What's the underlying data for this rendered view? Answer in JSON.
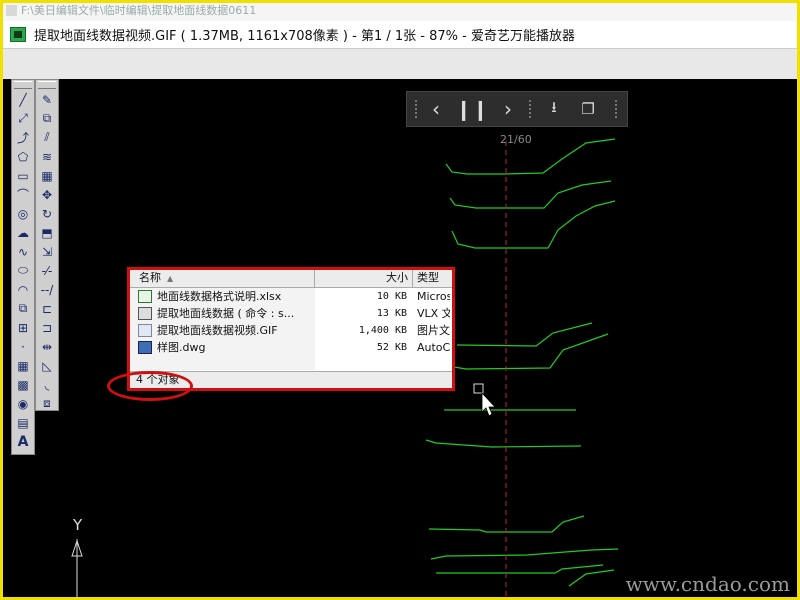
{
  "breadcrumb_path": "F:\\美日编辑文件\\临时编辑\\提取地面线数据0611",
  "window": {
    "title": "提取地面线数据视频.GIF ( 1.37MB, 1161x708像素 ) - 第1 / 1张 - 87% - 爱奇艺万能播放器"
  },
  "viewer": {
    "prev_icon": "chevron-left",
    "pause_icon": "pause",
    "next_icon": "chevron-right",
    "save_icon": "download",
    "copy_icon": "copy",
    "page_counter": "21/60"
  },
  "explorer": {
    "columns": {
      "name": "名称",
      "size": "大小",
      "type": "类型"
    },
    "files": [
      {
        "name": "地面线数据格式说明.xlsx",
        "size": "10 KB",
        "type": "Micros",
        "icon": "excel-file-icon"
      },
      {
        "name": "提取地面线数据 ( 命令 : s...",
        "size": "13 KB",
        "type": "VLX 文",
        "icon": "vlx-file-icon"
      },
      {
        "name": "提取地面线数据视频.GIF",
        "size": "1,400 KB",
        "type": "图片文",
        "icon": "image-file-icon"
      },
      {
        "name": "样图.dwg",
        "size": "52 KB",
        "type": "AutoCA",
        "icon": "dwg-file-icon"
      }
    ],
    "status": "4 个对象"
  },
  "cad": {
    "ucs_y_label": "Y",
    "toolbar_left": [
      "line",
      "xline",
      "pline",
      "polygon",
      "rectangle",
      "arc",
      "circle",
      "revcloud",
      "spline",
      "ellipse",
      "ellipse-arc",
      "insert-block",
      "make-block",
      "point",
      "hatch",
      "gradient",
      "region",
      "table",
      "mtext"
    ],
    "toolbar_modify": [
      "erase",
      "copy",
      "mirror",
      "offset",
      "array",
      "move",
      "rotate",
      "scale",
      "stretch",
      "trim",
      "extend",
      "break-at-point",
      "break",
      "join",
      "chamfer",
      "fillet",
      "explode"
    ],
    "line_color": "#22cc22",
    "axis_color": "#cc2222"
  },
  "watermark": "www.cndao.com",
  "colors": {
    "frame": "#f0e000",
    "highlight": "#d01010"
  }
}
